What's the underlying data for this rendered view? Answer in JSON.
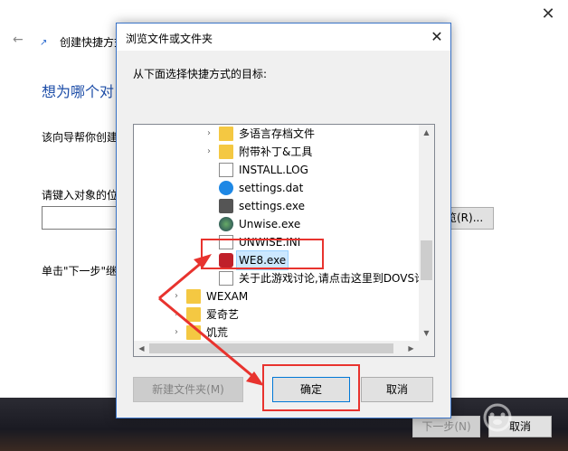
{
  "wizard": {
    "title": "创建快捷方式",
    "heading": "想为哪个对",
    "description": "该向导帮你创建",
    "location_prompt": "请键入对象的位",
    "browse_label": "览(R)...",
    "hint": "单击\"下一步\"继",
    "next_label": "下一步(N)",
    "cancel_label": "取消",
    "close_glyph": "✕",
    "back_glyph": "←"
  },
  "dialog": {
    "title": "浏览文件或文件夹",
    "prompt": "从下面选择快捷方式的目标:",
    "close_glyph": "✕",
    "tree": [
      {
        "label": "多语言存档文件",
        "icon": "folder-icon",
        "expander": "›"
      },
      {
        "label": "附带补丁&工具",
        "icon": "folder-icon",
        "expander": "›"
      },
      {
        "label": "INSTALL.LOG",
        "icon": "document-icon",
        "expander": ""
      },
      {
        "label": "settings.dat",
        "icon": "media-file-icon",
        "expander": ""
      },
      {
        "label": "settings.exe",
        "icon": "settings-app-icon",
        "expander": ""
      },
      {
        "label": "Unwise.exe",
        "icon": "installer-icon",
        "expander": ""
      },
      {
        "label": "UNWISE.INI",
        "icon": "ini-file-icon",
        "expander": ""
      },
      {
        "label": "WE8.exe",
        "icon": "game-exe-icon",
        "expander": ""
      },
      {
        "label": "关于此游戏讨论,请点击这里到DOVS论",
        "icon": "shortcut-icon",
        "expander": ""
      },
      {
        "label": "WEXAM",
        "icon": "folder-icon",
        "expander": "›"
      },
      {
        "label": "爱奇艺",
        "icon": "folder-icon",
        "expander": "›"
      },
      {
        "label": "饥荒",
        "icon": "folder-icon",
        "expander": "›"
      }
    ],
    "new_folder_label": "新建文件夹(M)",
    "ok_label": "确定",
    "cancel_label": "取消"
  },
  "colors": {
    "annotation": "#e8332e",
    "folder": "#f4c842",
    "selection": "#cce8ff",
    "accent": "#0078d7"
  }
}
